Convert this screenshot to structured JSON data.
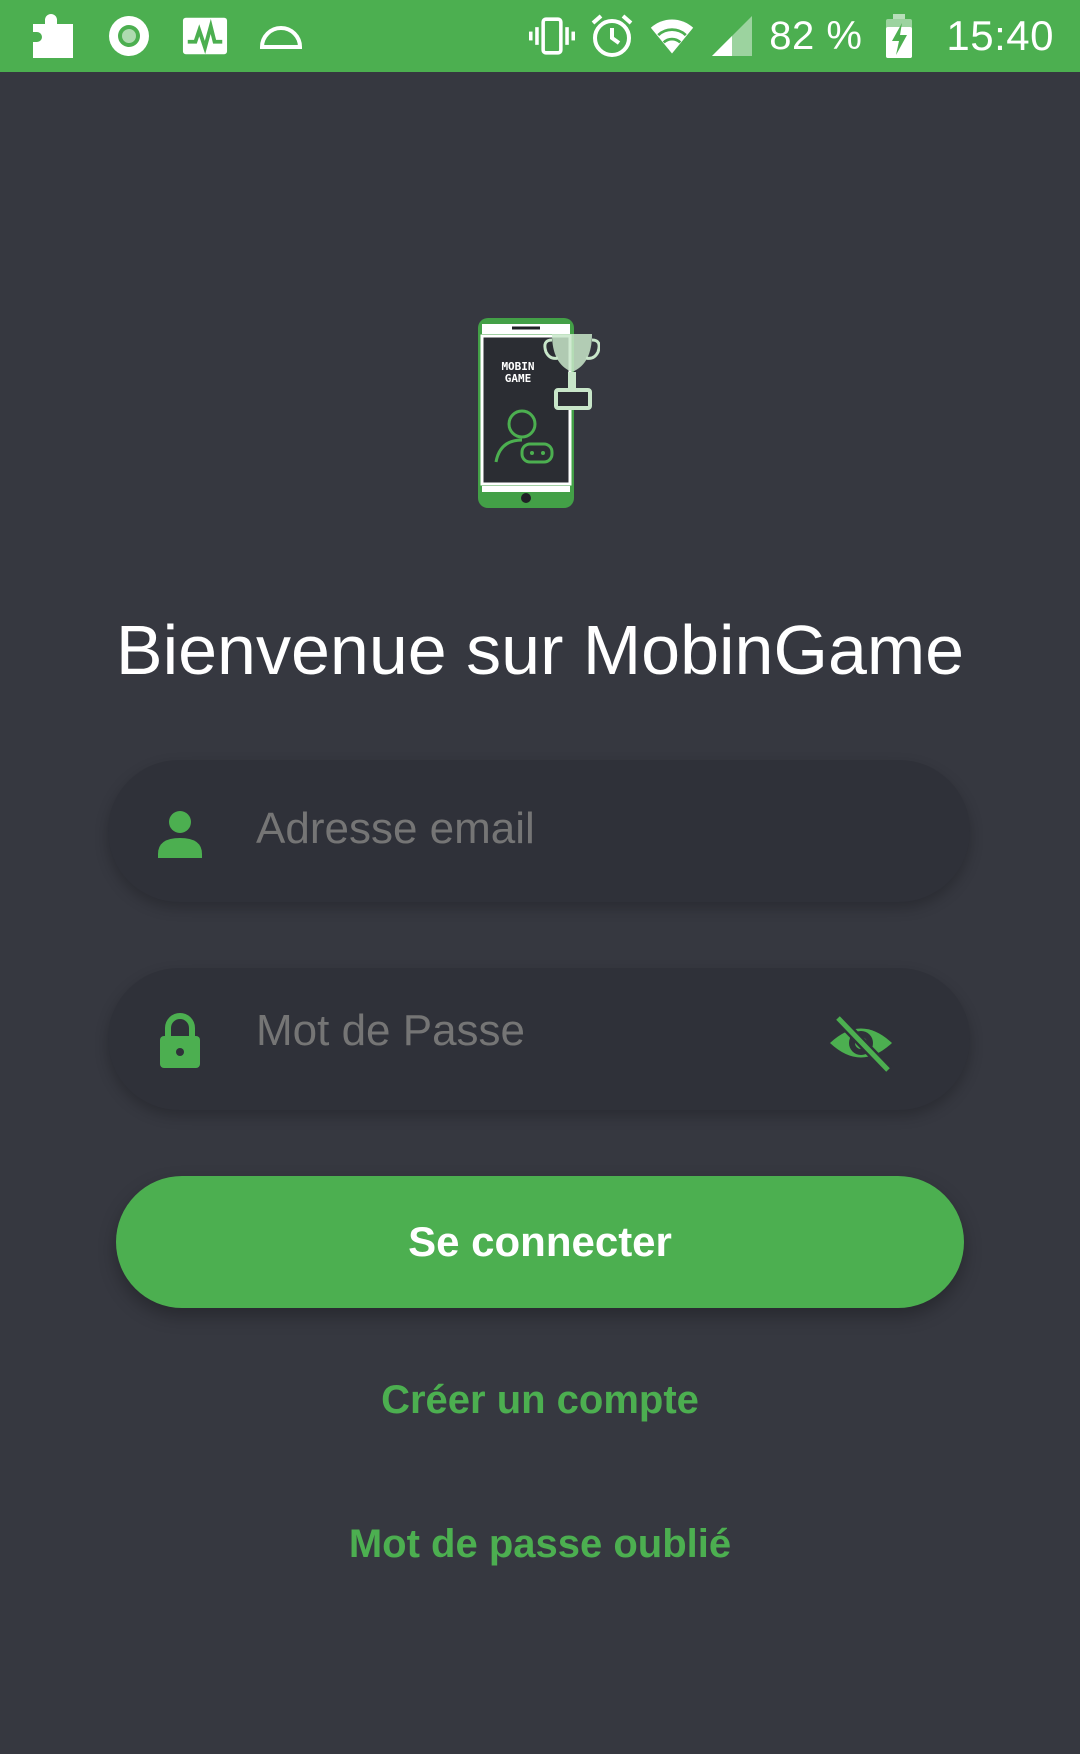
{
  "status_bar": {
    "battery_percent": "82 %",
    "time": "15:40",
    "left_icons": [
      "puzzle-icon",
      "record-icon",
      "activity-chart-icon",
      "half-circle-icon"
    ],
    "right_icons": [
      "vibrate-icon",
      "alarm-icon",
      "wifi-icon",
      "cell-signal-icon",
      "battery-charging-icon"
    ]
  },
  "logo": {
    "text_line1": "MOBIN",
    "text_line2": "GAME"
  },
  "welcome_title": "Bienvenue sur MobinGame",
  "email_field": {
    "placeholder": "Adresse email",
    "icon": "person-icon"
  },
  "password_field": {
    "placeholder": "Mot de Passe",
    "icon": "lock-icon",
    "toggle_icon": "eye-off-icon"
  },
  "login_button": "Se connecter",
  "create_account_link": "Créer un compte",
  "forgot_password_link": "Mot de passe oublié",
  "colors": {
    "accent": "#4caf50",
    "background": "#363840",
    "field_background": "#2f3139",
    "text": "#ffffff"
  }
}
